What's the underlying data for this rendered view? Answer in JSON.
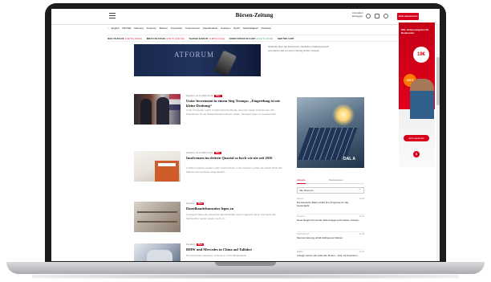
{
  "header": {
    "logo": "Börsen-Zeitung",
    "top_links": [
      "Anmelden",
      "Einloggen"
    ],
    "subscribe_label": "Jetzt abonnieren"
  },
  "nav": {
    "home_icon": "home-icon",
    "items": [
      "English",
      "DEVISE",
      "Meinung",
      "Finanzen",
      "Banken",
      "Konjunktur",
      "Unternehmen",
      "Kapitalmärkte",
      "Analysen",
      "Recht",
      "Nachhaltigkeit",
      "Podcasts"
    ]
  },
  "ticker": [
    {
      "name": "DAX",
      "value": "15.211,22",
      "change": "-0,42 % (-63,41)",
      "dir": "neg"
    },
    {
      "name": "MDAX",
      "value": "26.715,39",
      "change": "-0,51 % (-137,11)",
      "dir": "neg"
    },
    {
      "name": "TecDAX",
      "value": "3.224,67",
      "change": "-0,28 % (-9,11)",
      "dir": "neg"
    },
    {
      "name": "EURO STOXX 50",
      "value": "4.297",
      "change": "+0,12 % (+5,11)",
      "dir": "pos"
    },
    {
      "name": "S&P 500",
      "value": "4.337",
      "change": "",
      "dir": "pos"
    }
  ],
  "hero": {
    "banner": "ATFORUM",
    "text": "Stretcher über die Zukunft der deutschen Marktwirtschaft und warum alle an einem Strang ziehen müssen"
  },
  "articles": [
    {
      "meta": "Frankfurt, 04.11.2023 12:01",
      "tag": "Plus",
      "title": "Unter Investment in einem Sieg Trumps: „Eingreifung ist nie kleine Drohung“",
      "lead": "Unter Investoren macht Unsicherheit die Runde, was eine zweite Amtszeit des US-Präsidenten für die Weltwirtschaft bedeuten würde. Strategen raten zu Gelassenheit"
    },
    {
      "meta": "Frankfurt, 04.11.2023 11:40",
      "tag": "Plus",
      "title": "Insolvenzen im dritten Quartal so hoch wie nie seit 2016",
      "lead": "In dritten Quartal mussten mehr Unternehmen in die Insolvenz gehen als zuletzt 2016. Die Zahl der Firmenpleiten stieg deutlich"
    },
    {
      "meta": "Frankfurt",
      "tag": "Plus",
      "title": "Einzelhandelsumsätze legen zu",
      "lead": "Im August haben die deutschen Einzelhändler mehr umgesetzt als im Vormonat. Die Verbraucher kaufen wieder mehr ein"
    },
    {
      "meta": "Frankfurt",
      "tag": "Plus",
      "title": "BMW und Mercedes in China auf Talfahrt",
      "lead": "Die deutschen Autobauer verlieren in China Marktanteile"
    }
  ],
  "mid_ad": {
    "brand": "DAL A"
  },
  "sidebar": {
    "tabs": [
      "Aktuelle",
      "Meistgelesen"
    ],
    "select_value": "Alle Ressorts",
    "items": [
      {
        "ressort": "Banken",
        "time": "12:04",
        "headline": "Die Deutsche Bank erhöht ihre Prognose für das Gesamtjahr"
      },
      {
        "ressort": "Finanzen",
        "time": "11:52",
        "headline": "Neue Regeln für Fonds: Was Anleger jetzt wissen müssen"
      },
      {
        "ressort": "Unternehmen",
        "time": "11:38",
        "headline": "Siemens Energy erhält Auftrag aus Nahost"
      },
      {
        "ressort": "Märkte",
        "time": "11:20",
        "headline": "Anleger setzen auf sinkende Zinsen – Dax mit Gewinnen"
      }
    ]
  },
  "sky_ad": {
    "headline": "DSL-Aktionsangebot für Neukunden",
    "price": "19€",
    "bonus": "100 €",
    "cta": "Jetzt wechseln",
    "brand_letter": "S"
  }
}
